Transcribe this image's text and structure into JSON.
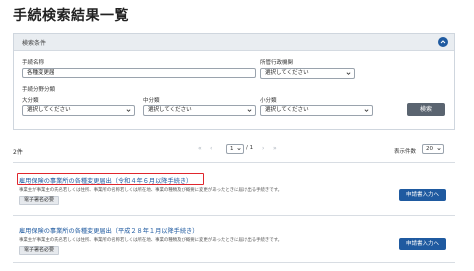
{
  "page": {
    "title": "手続検索結果一覧"
  },
  "search": {
    "panel_title": "検索条件",
    "name_label": "手続名称",
    "name_value": "各種変更届",
    "agency_label": "所管行政機関",
    "agency_value": "選択してください",
    "category_label": "手続分野分類",
    "major_label": "大分類",
    "major_value": "選択してください",
    "middle_label": "中分類",
    "middle_value": "選択してください",
    "minor_label": "小分類",
    "minor_value": "選択してください",
    "search_button": "検索"
  },
  "results_bar": {
    "count": "2件",
    "first": "«",
    "prev": "‹",
    "page": "1",
    "total": "/ 1",
    "next": "›",
    "last": "»",
    "per_page_label": "表示件数",
    "per_page_value": "20"
  },
  "results": [
    {
      "title": "雇用保険の事業所の各種変更届出（令和４年６月以降手続き）",
      "description": "事業主が事業主の氏名若しくは住所、事業所の名称若しくは所在地、事業の種類及び概要に変更があったときに届け出る手続きです。",
      "badge": "電子署名必要",
      "apply": "申請書入力へ"
    },
    {
      "title": "雇用保険の事業所の各種変更届出（平成２８年１月以降手続き）",
      "description": "事業主が事業主の氏名若しくは住所、事業所の名称若しくは所在地、事業の種類及び概要に変更があったときに届け出る手続きです。",
      "badge": "電子署名必要",
      "apply": "申請書入力へ"
    }
  ],
  "colors": {
    "accent": "#1f5aa0",
    "highlight": "#e0262d",
    "search_button": "#5a6470"
  }
}
